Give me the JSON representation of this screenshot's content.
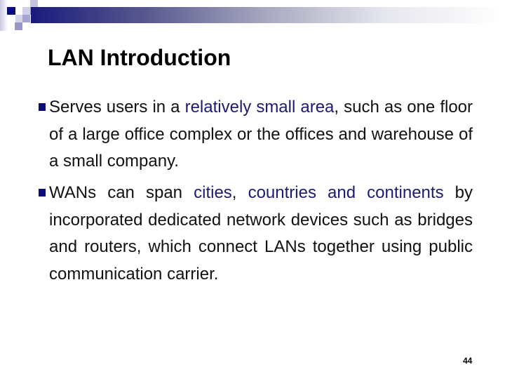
{
  "slide": {
    "title": "LAN Introduction",
    "page_number": "44",
    "accent_color": "#1a1a7c",
    "bullets": [
      {
        "pre": "Serves users in a ",
        "highlight": "relatively small area",
        "post": ", such as one floor of a large office complex or the offices and warehouse of a small company."
      },
      {
        "pre": "WANs can span ",
        "highlight": "cities",
        "mid": ", ",
        "highlight2": "countries and continents",
        "post": " by incorporated dedicated network devices such as bridges and routers, which connect LANs together using public communication carrier."
      }
    ]
  },
  "icons": {
    "bullet": "square-bullet-icon",
    "decoration": "gradient-header-bar"
  }
}
